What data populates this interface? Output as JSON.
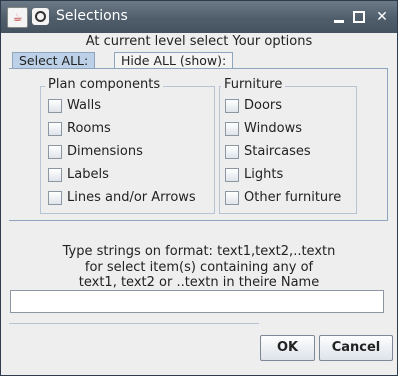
{
  "window": {
    "title": "Selections"
  },
  "dialog": {
    "header": "At current level select Your options",
    "tabs": [
      {
        "label": "Select ALL:"
      },
      {
        "label": "Hide ALL (show):"
      }
    ]
  },
  "plan_components": {
    "title": "Plan components",
    "items": [
      {
        "label": "Walls",
        "checked": false
      },
      {
        "label": "Rooms",
        "checked": false
      },
      {
        "label": "Dimensions",
        "checked": false
      },
      {
        "label": "Labels",
        "checked": false
      },
      {
        "label": "Lines and/or Arrows",
        "checked": false
      }
    ]
  },
  "furniture": {
    "title": "Furniture",
    "items": [
      {
        "label": "Doors",
        "checked": false
      },
      {
        "label": "Windows",
        "checked": false
      },
      {
        "label": "Staircases",
        "checked": false
      },
      {
        "label": "Lights",
        "checked": false
      },
      {
        "label": "Other furniture",
        "checked": false
      }
    ]
  },
  "filter": {
    "line1": "Type strings on format: text1,text2,..textn",
    "line2": "for select item(s) containing any of",
    "line3": "text1, text2 or ..textn in theire Name",
    "value": ""
  },
  "buttons": {
    "ok": "OK",
    "cancel": "Cancel"
  }
}
